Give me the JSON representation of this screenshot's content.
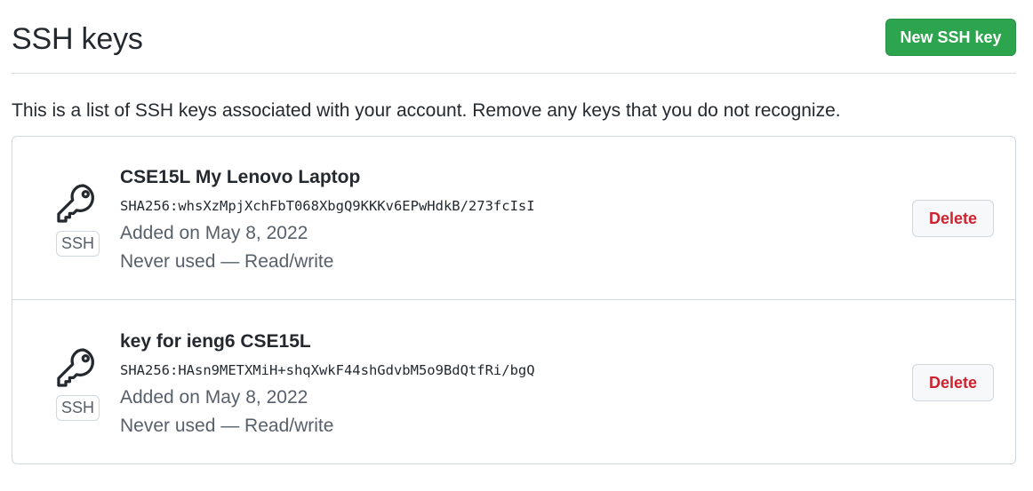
{
  "header": {
    "title": "SSH keys",
    "new_key_label": "New SSH key"
  },
  "description": "This is a list of SSH keys associated with your account. Remove any keys that you do not recognize.",
  "keys": [
    {
      "title": "CSE15L My Lenovo Laptop",
      "fingerprint": "SHA256:whsXzMpjXchFbT068XbgQ9KKKv6EPwHdkB/273fcIsI",
      "added": "Added on May 8, 2022",
      "usage": "Never used — Read/write",
      "badge": "SSH",
      "icon": "key-icon",
      "delete_label": "Delete"
    },
    {
      "title": "key for ieng6 CSE15L",
      "fingerprint": "SHA256:HAsn9METXMiH+shqXwkF44shGdvbM5o9BdQtfRi/bgQ",
      "added": "Added on May 8, 2022",
      "usage": "Never used — Read/write",
      "badge": "SSH",
      "icon": "key-icon",
      "delete_label": "Delete"
    }
  ],
  "colors": {
    "primary_button": "#2da44e",
    "danger_text": "#cf222e",
    "border": "#d0d7de",
    "muted_text": "#57606a"
  }
}
